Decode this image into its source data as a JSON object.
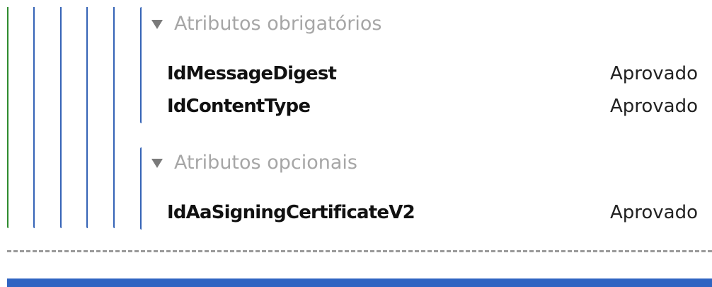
{
  "groups": [
    {
      "header": "Atributos obrigatórios",
      "rows": [
        {
          "name": "IdMessageDigest",
          "status": "Aprovado"
        },
        {
          "name": "IdContentType",
          "status": "Aprovado"
        }
      ]
    },
    {
      "header": "Atributos opcionais",
      "rows": [
        {
          "name": "IdAaSigningCertificateV2",
          "status": "Aprovado"
        }
      ]
    }
  ]
}
